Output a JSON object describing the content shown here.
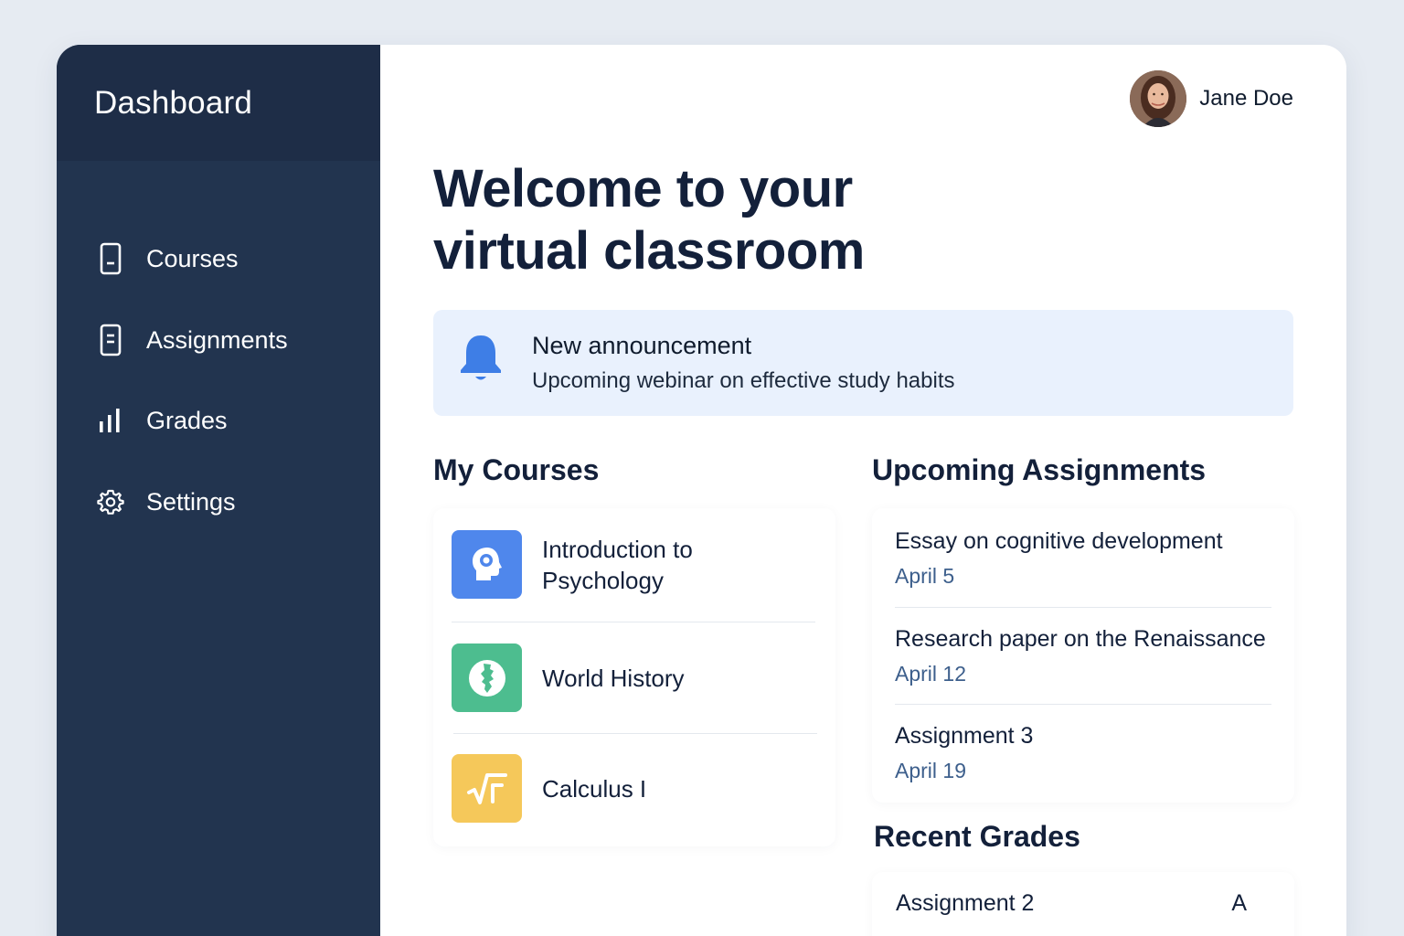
{
  "sidebar": {
    "title": "Dashboard",
    "items": [
      {
        "label": "Courses",
        "icon": "bookmark-icon"
      },
      {
        "label": "Assignments",
        "icon": "document-icon"
      },
      {
        "label": "Grades",
        "icon": "bar-chart-icon"
      },
      {
        "label": "Settings",
        "icon": "gear-icon"
      }
    ]
  },
  "user": {
    "name": "Jane Doe"
  },
  "welcome": {
    "line1": "Welcome to your",
    "line2": "virtual classroom"
  },
  "announcement": {
    "icon": "bell-icon",
    "title": "New announcement",
    "body": "Upcoming webinar on effective study habits"
  },
  "my_courses": {
    "title": "My Courses",
    "items": [
      {
        "name": "Introduction to Psychology",
        "icon": "head-icon",
        "color": "#4f87ec"
      },
      {
        "name": "World History",
        "icon": "globe-icon",
        "color": "#4dbd8f"
      },
      {
        "name": "Calculus I",
        "icon": "square-root-icon",
        "color": "#f5c85a"
      }
    ]
  },
  "upcoming_assignments": {
    "title": "Upcoming Assignments",
    "items": [
      {
        "title": "Essay on cognitive development",
        "date": "April 5"
      },
      {
        "title": "Research paper on the Renaissance",
        "date": "April 12"
      },
      {
        "title": "Assignment 3",
        "date": "April 19"
      }
    ]
  },
  "recent_grades": {
    "title": "Recent Grades",
    "items": [
      {
        "name": "Assignment 2",
        "grade": "A"
      }
    ]
  },
  "colors": {
    "sidebar": "#22344f",
    "sidebar_header": "#1e2d47",
    "announcement_bg": "#e9f1fd",
    "accent_blue": "#3e7ee6",
    "date_text": "#3d5f8c"
  }
}
